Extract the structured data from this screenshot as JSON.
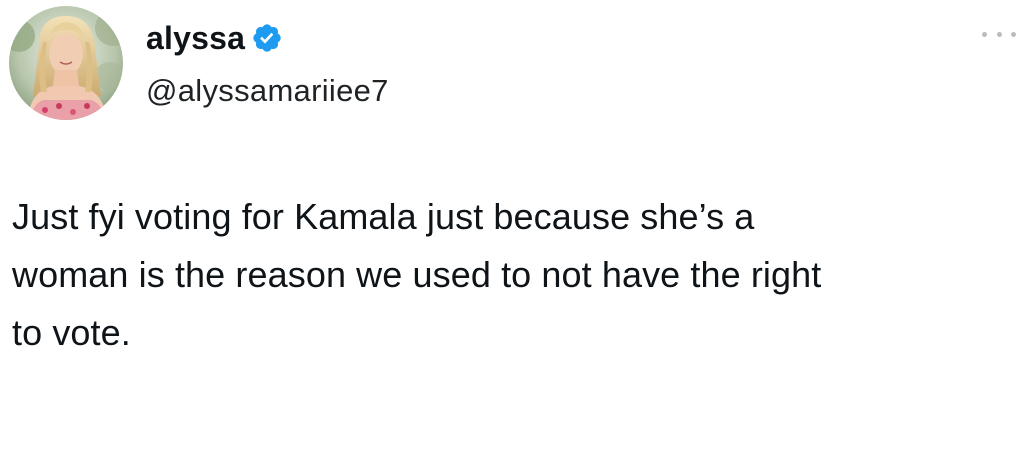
{
  "author": {
    "display_name": "alyssa",
    "handle": "@alyssamariiee7",
    "verified": true,
    "verified_color": "#1d9bf0",
    "avatar_icon": "profile-photo"
  },
  "menu": {
    "icon": "more-options-icon"
  },
  "tweet": {
    "text_lines": [
      "Just fyi voting for Kamala just because she’s a",
      "woman is the reason we used to not have the right",
      "to vote."
    ]
  }
}
